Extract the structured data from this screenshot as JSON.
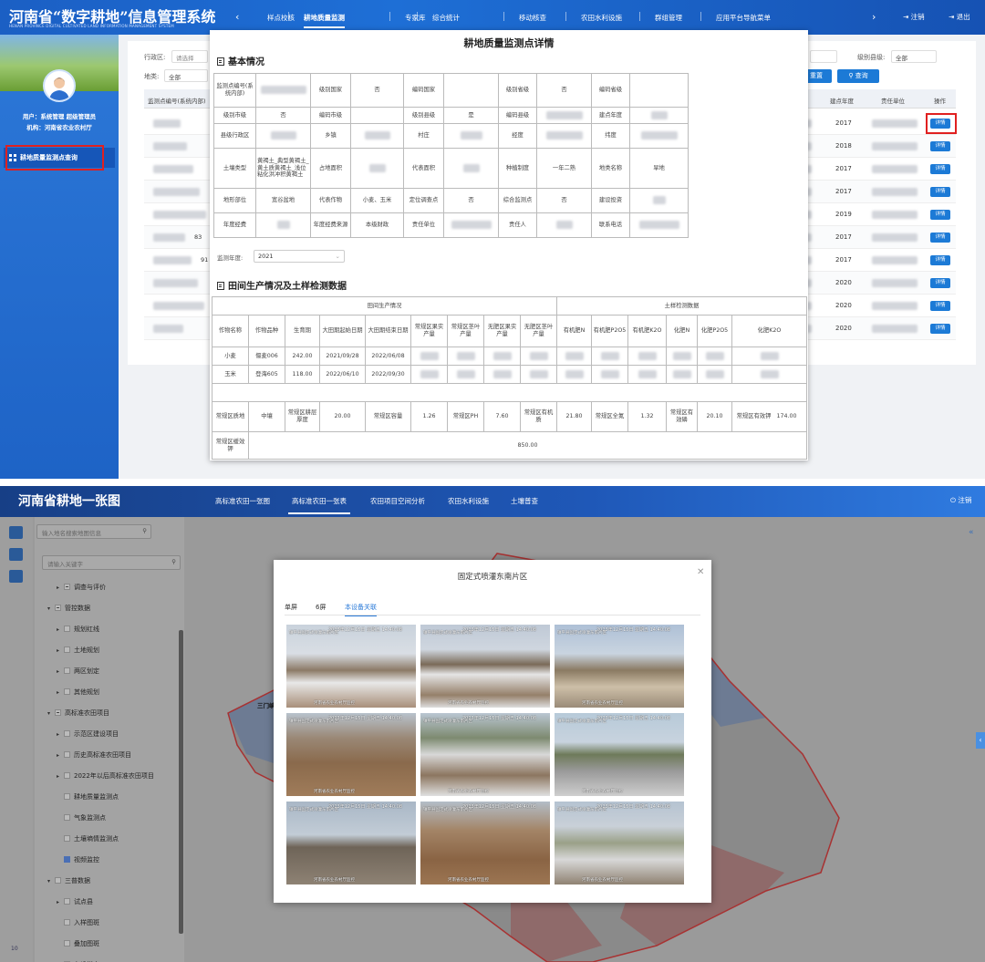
{
  "panel1": {
    "title": "河南省“数字耕地”信息管理系统",
    "subtitle": "HENAN PROVINCE DIGITAL CULTIVATED LAND INFORMATION MANAGEMENT SYSTEM",
    "nav_prev": "‹",
    "nav_next": "›",
    "nav": [
      "样点校核",
      "耕地质量监测",
      "专家库",
      "综合统计",
      "移动核查",
      "农田水利设施",
      "群组管理",
      "应用平台导航菜单"
    ],
    "logout_label": "注销",
    "exit_label": "退出",
    "user": "用户：系统管理 超级管理员",
    "org": "机构：河南省农业农村厅",
    "menu_item": "耕地质量监测点查询",
    "filters": {
      "admin_label": "行政区:",
      "admin_placeholder": "请选择",
      "landuse_label": "地类:",
      "landuse_value": "全部",
      "level_label": "级别县级:",
      "level_value": "全部",
      "reset_label": "重置",
      "query_label": "查询"
    },
    "table_headers": {
      "code": "监测点编号(系统内部)",
      "year": "建点年度",
      "unit": "责任单位",
      "op": "操作"
    },
    "rows": [
      {
        "code_suffix": "",
        "year": "2017",
        "action": "详情"
      },
      {
        "code_suffix": "",
        "year": "2018",
        "action": "详情"
      },
      {
        "code_suffix": "",
        "year": "2017",
        "action": "详情"
      },
      {
        "code_suffix": "",
        "year": "2017",
        "action": "详情"
      },
      {
        "code_suffix": "",
        "year": "2019",
        "action": "详情"
      },
      {
        "code_suffix": "83",
        "year": "2017",
        "action": "详情"
      },
      {
        "code_suffix": "91",
        "year": "2017",
        "action": "详情"
      },
      {
        "code_suffix": "",
        "year": "2020",
        "action": "详情"
      },
      {
        "code_suffix": "",
        "year": "2020",
        "action": "详情"
      },
      {
        "code_suffix": "",
        "year": "2020",
        "action": "详情"
      }
    ],
    "modal": {
      "title": "耕地质量监测点详情",
      "section_basic": "基本情况",
      "basic": {
        "point_code_label": "监测点编号(系统内部)",
        "nat_level_label": "级别国家",
        "nat_level_val": "否",
        "nat_code_label": "编码国家",
        "prov_level_label": "级别省级",
        "prov_level_val": "否",
        "prov_code_label": "编码省级",
        "city_level_label": "级别市级",
        "city_level_val": "否",
        "city_code_label": "编码市级",
        "county_level_label": "级别县级",
        "county_level_val": "是",
        "county_code_label": "编码县级",
        "year_label": "建点年度",
        "county_label": "县级行政区",
        "town_label": "乡镇",
        "village_label": "村庄",
        "lon_label": "经度",
        "lat_label": "纬度",
        "soil_label": "土壤类型",
        "soil_val": "黄褐土_典型黄褐土_黄土质黄褐土_浅位粘化洪冲积黄褐土",
        "area_label": "占地面积",
        "rep_area_label": "代表面积",
        "system_label": "种植制度",
        "system_val": "一年二熟",
        "landname_label": "地类名称",
        "landname_val": "旱地",
        "terrain_label": "地形部位",
        "terrain_val": "宽谷盆地",
        "crop_label": "代表作物",
        "crop_val": "小麦、玉米",
        "fixed_label": "定位调查点",
        "fixed_val": "否",
        "comp_label": "综合监测点",
        "comp_val": "否",
        "invest_label": "建设投资",
        "fund_label": "年度经费",
        "fund_src_label": "年度经费来源",
        "fund_src_val": "本级财政",
        "resp_unit_label": "责任单位",
        "resp_person_label": "责任人",
        "phone_label": "联系电话"
      },
      "year_label": "监测年度:",
      "year_value": "2021",
      "section_field": "田间生产情况及土样检测数据",
      "group_prod": "田间生产情况",
      "group_soil": "土样检测数据",
      "prod_headers": [
        "作物名称",
        "作物品种",
        "生育期",
        "大田期起始日期",
        "大田期结束日期",
        "常规区果实产量",
        "常规区茎叶产量",
        "无肥区果实产量",
        "无肥区茎叶产量"
      ],
      "soil_headers": [
        "有机肥N",
        "有机肥P2O5",
        "有机肥K2O",
        "化肥N",
        "化肥P2O5",
        "化肥K2O"
      ],
      "crops": [
        {
          "name": "小麦",
          "variety": "偃麦006",
          "period": "242.00",
          "start": "2021/09/28",
          "end": "2022/06/08"
        },
        {
          "name": "玉米",
          "variety": "登海605",
          "period": "118.00",
          "start": "2022/06/10",
          "end": "2022/09/30"
        }
      ],
      "soil_row": {
        "texture_label": "常规区质地",
        "texture_val": "中壤",
        "depth_label": "常规区耕层厚度",
        "depth_val": "20.00",
        "bulk_label": "常规区容量",
        "bulk_val": "1.26",
        "ph_label": "常规区PH",
        "ph_val": "7.60",
        "om_label": "常规区有机质",
        "om_val": "21.80",
        "tn_label": "常规区全氮",
        "tn_val": "1.32",
        "ap_label": "常规区有效磷",
        "ap_val": "20.10",
        "ak_label": "常规区有效钾",
        "ak_val": "174.00"
      },
      "slow_k_label": "常规区缓效钾",
      "slow_k_val": "850.00"
    }
  },
  "panel2": {
    "title": "河南省耕地一张图",
    "nav": [
      "高标准农田一张图",
      "高标准农田一张表",
      "农田项目空间分析",
      "农田水利设施",
      "土壤普查"
    ],
    "logout": "注销",
    "search_placeholder": "输入地名搜索地图信息",
    "tree_search_placeholder": "请输入关键字",
    "map_label": "三门峡",
    "tree": [
      {
        "label": "调查与评价",
        "indent": 2,
        "state": "part",
        "caret": "▸"
      },
      {
        "label": "管控数据",
        "indent": 1,
        "state": "part",
        "caret": "▾"
      },
      {
        "label": "规划红线",
        "indent": 2,
        "state": "off",
        "caret": "▸"
      },
      {
        "label": "土地规划",
        "indent": 2,
        "state": "off",
        "caret": "▸"
      },
      {
        "label": "两区划定",
        "indent": 2,
        "state": "off",
        "caret": "▸"
      },
      {
        "label": "其他规划",
        "indent": 2,
        "state": "off",
        "caret": "▸"
      },
      {
        "label": "高标准农田项目",
        "indent": 1,
        "state": "part",
        "caret": "▾"
      },
      {
        "label": "示范区建设项目",
        "indent": 2,
        "state": "off",
        "caret": "▸"
      },
      {
        "label": "历史高标准农田项目",
        "indent": 2,
        "state": "off",
        "caret": "▸"
      },
      {
        "label": "2022年以后高标准农田项目",
        "indent": 2,
        "state": "off",
        "caret": "▸"
      },
      {
        "label": "耕地质量监测点",
        "indent": 2,
        "state": "off",
        "caret": ""
      },
      {
        "label": "气象监测点",
        "indent": 2,
        "state": "off",
        "caret": ""
      },
      {
        "label": "土壤墒情监测点",
        "indent": 2,
        "state": "off",
        "caret": ""
      },
      {
        "label": "视频监控",
        "indent": 2,
        "state": "chk",
        "caret": ""
      },
      {
        "label": "三普数据",
        "indent": 1,
        "state": "off",
        "caret": "▾"
      },
      {
        "label": "试点县",
        "indent": 2,
        "state": "off",
        "caret": "▸"
      },
      {
        "label": "入样图斑",
        "indent": 2,
        "state": "off",
        "caret": ""
      },
      {
        "label": "叠加图斑",
        "indent": 2,
        "state": "off",
        "caret": ""
      },
      {
        "label": "布设样点",
        "indent": 2,
        "state": "off",
        "caret": ""
      }
    ],
    "footer_left": "10",
    "modal": {
      "title": "固定式喷灌东南片区",
      "tabs": [
        "单屏",
        "6屏",
        "本设备关联"
      ],
      "active_tab": 2,
      "cam_time": "2023年12月15日 星期五 14:40:08",
      "cam_loc": "镇平县固定式喷灌东南片区",
      "cam_foot": "河南省农业农村厅监控",
      "cameras": [
        {
          "scene": "snow-road"
        },
        {
          "scene": "snow-field"
        },
        {
          "scene": "field-road"
        },
        {
          "scene": "brown-field"
        },
        {
          "scene": "snow-reel"
        },
        {
          "scene": "crosswalk"
        },
        {
          "scene": "flat-field"
        },
        {
          "scene": "brown-flat"
        },
        {
          "scene": "canal"
        }
      ]
    }
  }
}
